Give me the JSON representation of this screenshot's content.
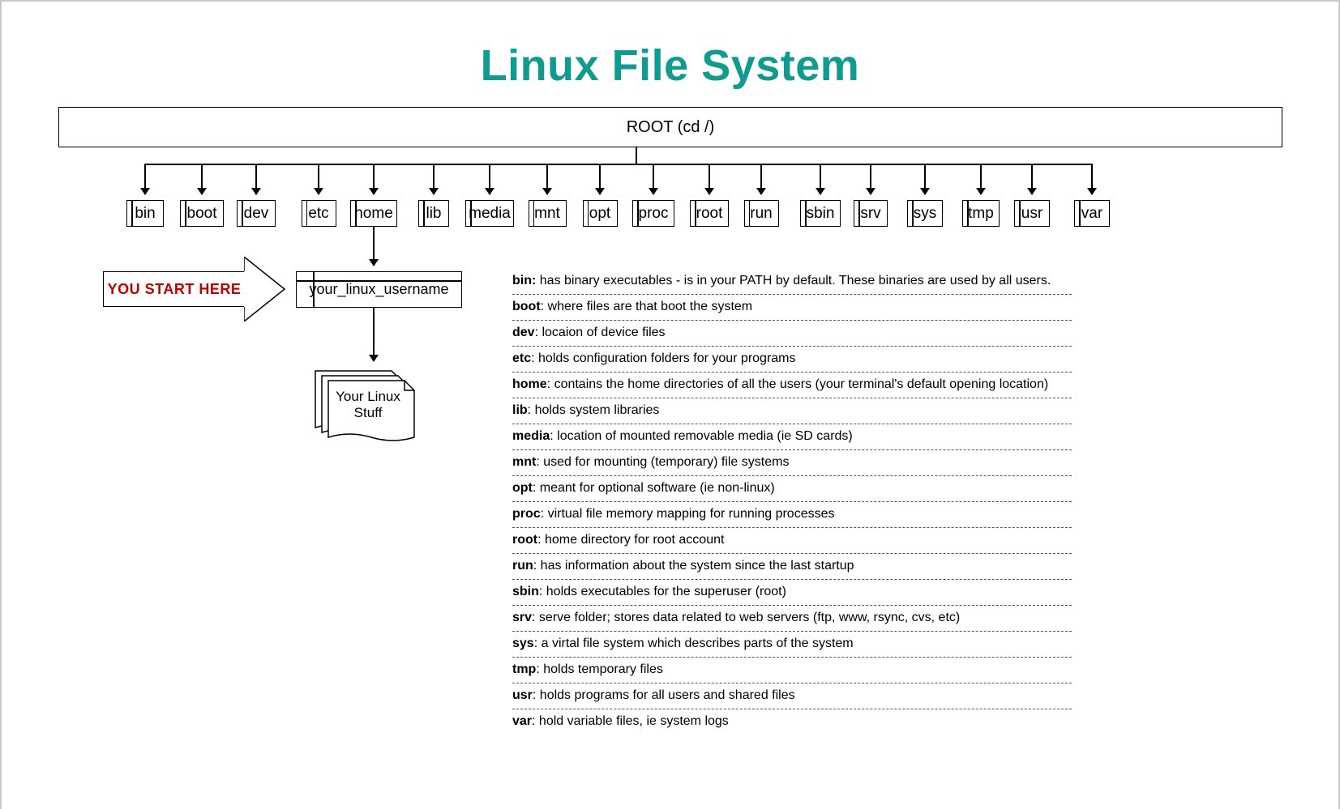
{
  "title": "Linux File System",
  "root_label": "ROOT  (cd /)",
  "dirs": [
    "bin",
    "boot",
    "dev",
    "etc",
    "home",
    "lib",
    "media",
    "mnt",
    "opt",
    "proc",
    "root",
    "run",
    "sbin",
    "srv",
    "sys",
    "tmp",
    "usr",
    "var"
  ],
  "start_here_label": "YOU START HERE",
  "username_label": "your_linux_username",
  "stuff_label_1": "Your Linux",
  "stuff_label_2": "Stuff",
  "descriptions": [
    {
      "term": "bin:",
      "text": " has binary executables - is in your PATH by default. These binaries are used by all users."
    },
    {
      "term": "boot",
      "text": ": where files are that boot the system"
    },
    {
      "term": "dev",
      "text": ": locaion of device files"
    },
    {
      "term": "etc",
      "text": ": holds configuration folders for your programs"
    },
    {
      "term": "home",
      "text": ": contains the home directories of all the users (your terminal's default opening location)"
    },
    {
      "term": "lib",
      "text": ":  holds system libraries"
    },
    {
      "term": "media",
      "text": ": location of mounted removable media (ie SD cards)"
    },
    {
      "term": "mnt",
      "text": ": used for mounting (temporary) file systems"
    },
    {
      "term": "opt",
      "text": ": meant for optional software (ie non-linux)"
    },
    {
      "term": "proc",
      "text": ": virtual file memory mapping for running processes"
    },
    {
      "term": "root",
      "text": ": home directory for root account"
    },
    {
      "term": "run",
      "text": ": has information about the system since the last startup"
    },
    {
      "term": "sbin",
      "text": ": holds executables for the superuser (root)"
    },
    {
      "term": "srv",
      "text": ": serve folder; stores data related to web servers (ftp, www, rsync, cvs, etc)"
    },
    {
      "term": "sys",
      "text": ": a virtal file system which describes parts of the system"
    },
    {
      "term": "tmp",
      "text": ": holds temporary files"
    },
    {
      "term": "usr",
      "text": ": holds programs for all users and shared files"
    },
    {
      "term": "var",
      "text": ": hold variable files, ie system logs"
    }
  ],
  "layout": {
    "dir_centers": [
      177,
      247,
      314,
      391,
      459,
      533,
      602,
      673,
      738,
      804,
      873,
      937,
      1010,
      1072,
      1139,
      1208,
      1271,
      1345
    ],
    "dir_widths": [
      46,
      54,
      48,
      43,
      58,
      38,
      60,
      47,
      43,
      52,
      48,
      43,
      50,
      42,
      44,
      46,
      44,
      44
    ]
  }
}
